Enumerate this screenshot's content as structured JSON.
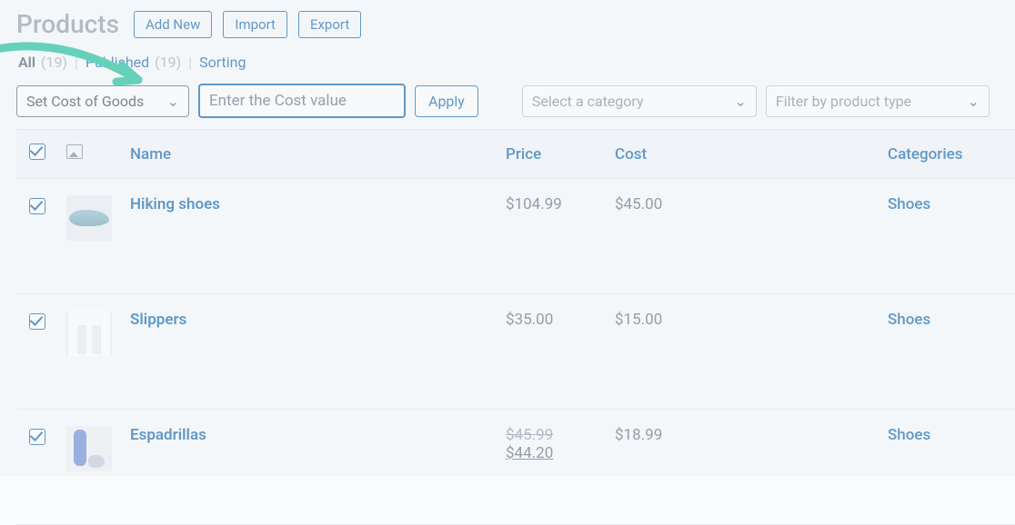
{
  "header": {
    "title": "Products",
    "add_new": "Add New",
    "import": "Import",
    "export": "Export"
  },
  "subtabs": {
    "all_label": "All",
    "all_count": "(19)",
    "published_label": "Published",
    "published_count": "(19)",
    "sorting": "Sorting",
    "sep": "|"
  },
  "actions": {
    "bulk_select": "Set Cost of Goods",
    "cost_placeholder": "Enter the Cost value",
    "apply": "Apply",
    "category_select": "Select a category",
    "type_select": "Filter by product type"
  },
  "columns": {
    "name": "Name",
    "price": "Price",
    "cost": "Cost",
    "categories": "Categories"
  },
  "rows": [
    {
      "name": "Hiking shoes",
      "price": "$104.99",
      "cost": "$45.00",
      "category": "Shoes",
      "thumb": "shoe"
    },
    {
      "name": "Slippers",
      "price": "$35.00",
      "cost": "$15.00",
      "category": "Shoes",
      "thumb": "legs"
    },
    {
      "name": "Espadrillas",
      "price_strike": "$45.99",
      "price_sale": "$44.20",
      "cost": "$18.99",
      "category": "Shoes",
      "thumb": "espa"
    }
  ]
}
